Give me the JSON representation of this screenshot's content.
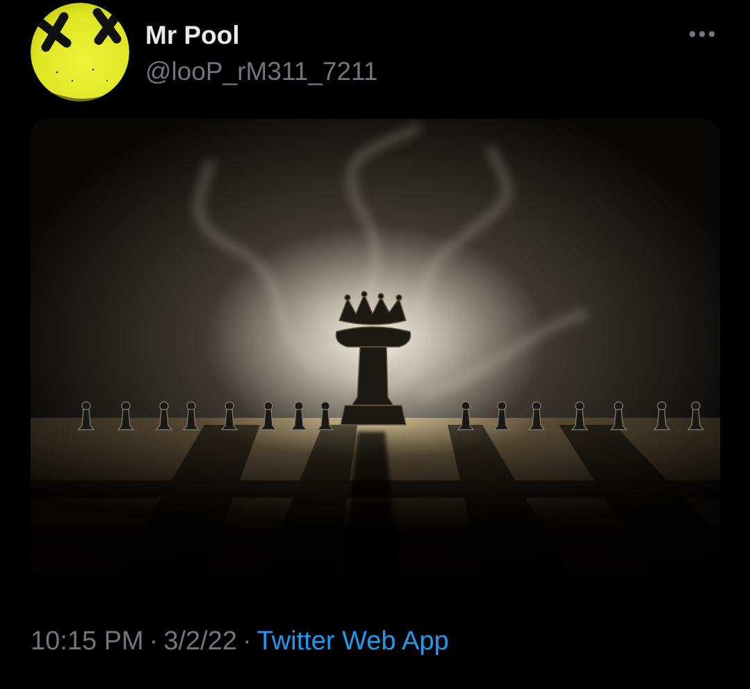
{
  "tweet": {
    "author": {
      "display_name": "Mr Pool",
      "handle": "@looP_rM311_7211",
      "avatar_color": "#e5ec2b"
    },
    "more_icon": "more-horizontal-icon",
    "media": {
      "description_icon": "chess-king-among-pawns-image"
    },
    "time": "10:15 PM",
    "date": "3/2/22",
    "separator": "·",
    "source": "Twitter Web App",
    "colors": {
      "background": "#000000",
      "name": "#e7e9ea",
      "muted": "#71767b",
      "link": "#1d9bf0"
    }
  }
}
